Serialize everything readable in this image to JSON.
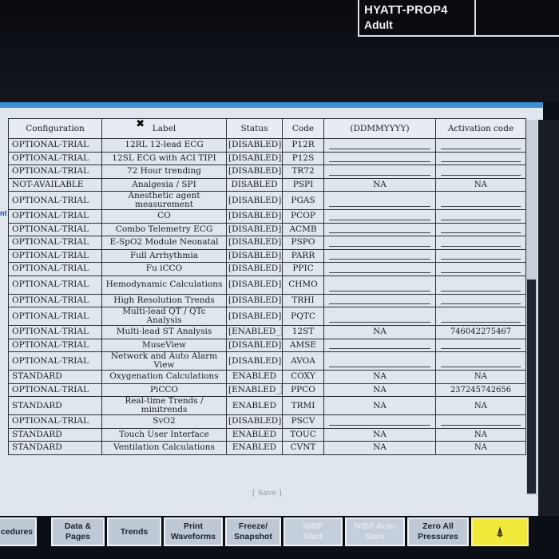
{
  "patient": {
    "name": "HYATT-PROP4",
    "type": "Adult"
  },
  "left_edge_text": "nt",
  "table": {
    "headers": {
      "configuration": "Configuration",
      "label": "Label",
      "status": "Status",
      "code": "Code",
      "expiration": "(DDMMYYYY)",
      "activation": "Activation code"
    },
    "rows": [
      {
        "config": "OPTIONAL-TRIAL",
        "label": "12RL 12-lead ECG",
        "status": "[DISABLED]",
        "code": "P12R",
        "expiration": "",
        "activation": "",
        "tall": false
      },
      {
        "config": "OPTIONAL-TRIAL",
        "label": "12SL ECG with ACI TIPI",
        "status": "[DISABLED]",
        "code": "P12S",
        "expiration": "",
        "activation": "",
        "tall": false
      },
      {
        "config": "OPTIONAL-TRIAL",
        "label": "72 Hour trending",
        "status": "[DISABLED]",
        "code": "TR72",
        "expiration": "",
        "activation": "",
        "tall": false
      },
      {
        "config": "NOT-AVAILABLE",
        "label": "Analgesia / SPI",
        "status": "DISABLED",
        "code": "PSPI",
        "expiration": "NA",
        "activation": "NA",
        "tall": false
      },
      {
        "config": "OPTIONAL-TRIAL",
        "label": "Anesthetic agent measurement",
        "status": "[DISABLED]",
        "code": "PGAS",
        "expiration": "",
        "activation": "",
        "tall": true
      },
      {
        "config": "OPTIONAL-TRIAL",
        "label": "CO",
        "status": "[DISABLED]",
        "code": "PCOP",
        "expiration": "",
        "activation": "",
        "tall": false
      },
      {
        "config": "OPTIONAL-TRIAL",
        "label": "Combo Telemetry ECG",
        "status": "[DISABLED]",
        "code": "ACMB",
        "expiration": "",
        "activation": "",
        "tall": false
      },
      {
        "config": "OPTIONAL-TRIAL",
        "label": "E-SpO2 Module Neonatal",
        "status": "[DISABLED]",
        "code": "PSPO",
        "expiration": "",
        "activation": "",
        "tall": false
      },
      {
        "config": "OPTIONAL-TRIAL",
        "label": "Full Arrhythmia",
        "status": "[DISABLED]",
        "code": "PARR",
        "expiration": "",
        "activation": "",
        "tall": false
      },
      {
        "config": "OPTIONAL-TRIAL",
        "label": "Fu  iCCO",
        "status": "[DISABLED]",
        "code": "PPIC",
        "expiration": "",
        "activation": "",
        "tall": false,
        "cursor": true
      },
      {
        "config": "OPTIONAL-TRIAL",
        "label": "Hemodynamic Calculations",
        "status": "[DISABLED]",
        "code": "CHMO",
        "expiration": "",
        "activation": "",
        "tall": true
      },
      {
        "config": "OPTIONAL-TRIAL",
        "label": "High Resolution Trends",
        "status": "[DISABLED]",
        "code": "TRHI",
        "expiration": "",
        "activation": "",
        "tall": false
      },
      {
        "config": "OPTIONAL-TRIAL",
        "label": "Multi-lead QT / QTc Analysis",
        "status": "[DISABLED]",
        "code": "PQTC",
        "expiration": "",
        "activation": "",
        "tall": true
      },
      {
        "config": "OPTIONAL-TRIAL",
        "label": "Multi-lead ST Analysis",
        "status": "[ENABLED_]",
        "code": "12ST",
        "expiration": "NA",
        "activation": "746042275467",
        "tall": false
      },
      {
        "config": "OPTIONAL-TRIAL",
        "label": "MuseView",
        "status": "[DISABLED]",
        "code": "AMSE",
        "expiration": "",
        "activation": "",
        "tall": false
      },
      {
        "config": "OPTIONAL-TRIAL",
        "label": "Network and Auto Alarm View",
        "status": "[DISABLED]",
        "code": "AVOA",
        "expiration": "",
        "activation": "",
        "tall": true
      },
      {
        "config": "STANDARD",
        "label": "Oxygenation Calculations",
        "status": "ENABLED",
        "code": "COXY",
        "expiration": "NA",
        "activation": "NA",
        "tall": false
      },
      {
        "config": "OPTIONAL-TRIAL",
        "label": "PiCCO",
        "status": "[ENABLED_]",
        "code": "PPCO",
        "expiration": "NA",
        "activation": "237245742656",
        "tall": false
      },
      {
        "config": "STANDARD",
        "label": "Real-time Trends / minitrends",
        "status": "ENABLED",
        "code": "TRMI",
        "expiration": "NA",
        "activation": "NA",
        "tall": true
      },
      {
        "config": "OPTIONAL-TRIAL",
        "label": "SvO2",
        "status": "[DISABLED]",
        "code": "PSCV",
        "expiration": "",
        "activation": "",
        "tall": false
      },
      {
        "config": "STANDARD",
        "label": "Touch User Interface",
        "status": "ENABLED",
        "code": "TOUC",
        "expiration": "NA",
        "activation": "NA",
        "tall": false
      },
      {
        "config": "STANDARD",
        "label": "Ventilation Calculations",
        "status": "ENABLED",
        "code": "CVNT",
        "expiration": "NA",
        "activation": "NA",
        "tall": false
      }
    ]
  },
  "save_label": "[ Save ]",
  "softkeys": [
    {
      "name": "procedures",
      "label": "cedures",
      "disabled": false
    },
    {
      "name": "data-pages",
      "label": "Data &\nPages",
      "disabled": false
    },
    {
      "name": "trends",
      "label": "Trends",
      "disabled": false
    },
    {
      "name": "print-waveforms",
      "label": "Print\nWaveforms",
      "disabled": false
    },
    {
      "name": "freeze-snapshot",
      "label": "Freeze/\nSnapshot",
      "disabled": false
    },
    {
      "name": "nibp-start",
      "label": "NIBP\nStart",
      "disabled": true
    },
    {
      "name": "nibp-auto-start",
      "label": "NIBP Auto\nStart",
      "disabled": true
    },
    {
      "name": "zero-all-pressures",
      "label": "Zero All\nPressures",
      "disabled": false
    },
    {
      "name": "alarm",
      "label": "⍋",
      "disabled": false,
      "alarm": true
    }
  ]
}
